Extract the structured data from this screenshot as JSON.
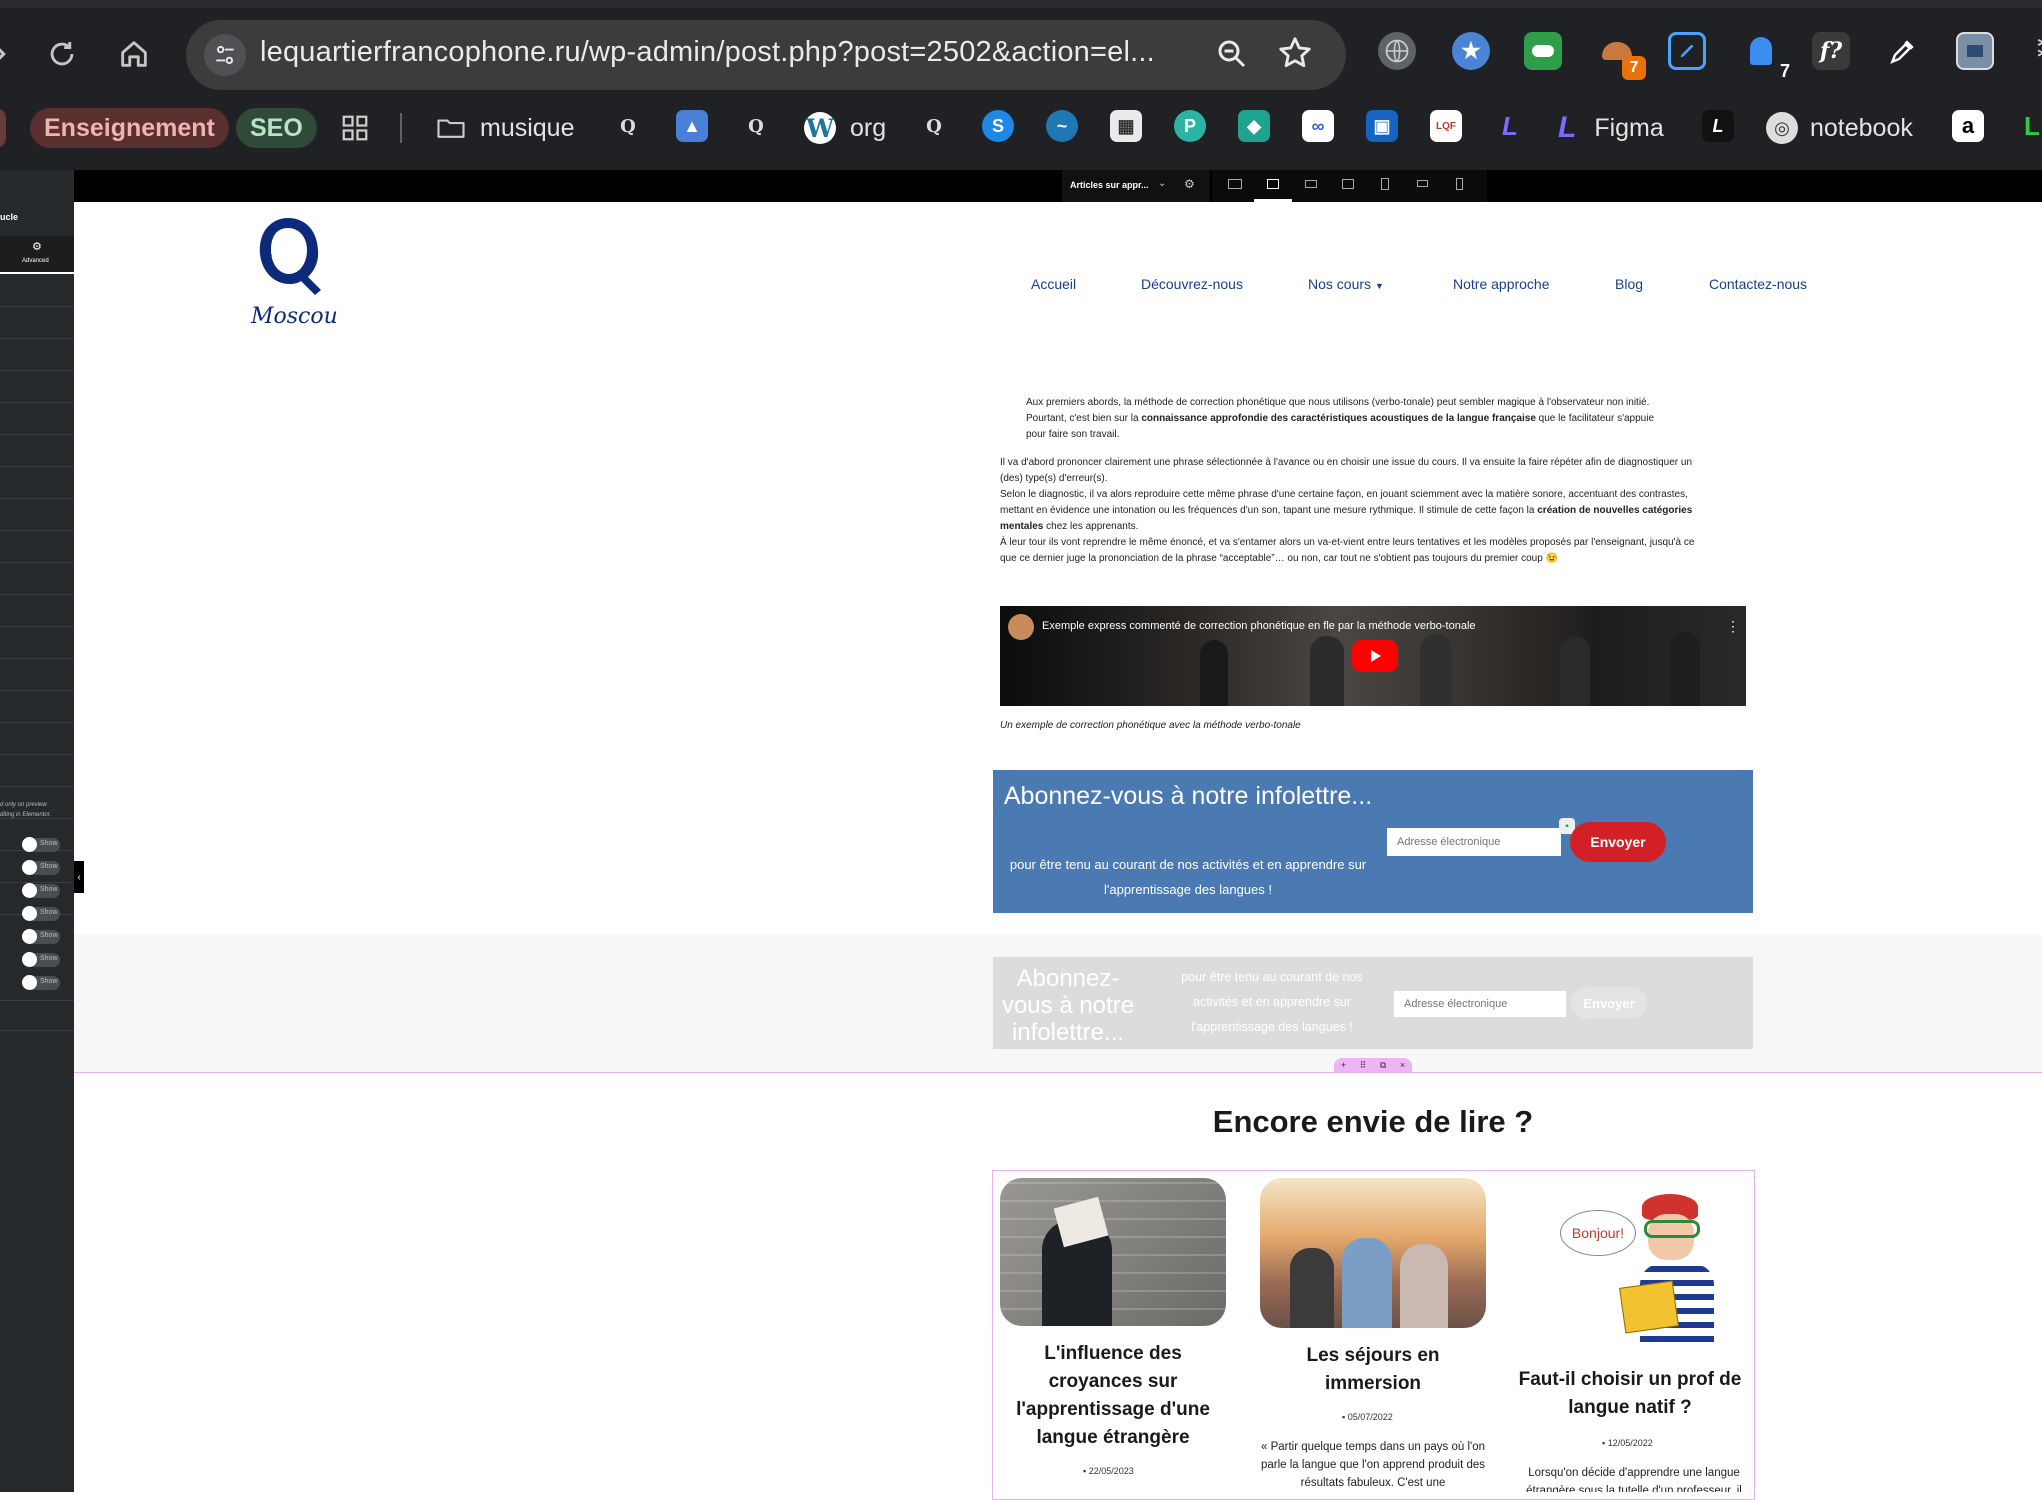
{
  "browser": {
    "url": "lequartierfrancophone.ru/wp-admin/post.php?post=2502&action=el...",
    "extensions": [
      {
        "name": "globe-icon",
        "badge": ""
      },
      {
        "name": "star-extension-icon",
        "badge": ""
      },
      {
        "name": "green-extension-icon",
        "badge": ""
      },
      {
        "name": "mushroom-extension-icon",
        "badge": "7"
      },
      {
        "name": "edit-extension-icon",
        "badge": ""
      },
      {
        "name": "ghost-extension-icon",
        "badge": "7"
      },
      {
        "name": "fx-extension-icon",
        "label": "f?"
      },
      {
        "name": "eyedropper-icon",
        "badge": ""
      },
      {
        "name": "image-info-icon",
        "badge": ""
      }
    ],
    "bookmarks": {
      "enseignement": "Enseignement",
      "seo": "SEO",
      "musique": "musique",
      "org": "org",
      "figma": "Figma",
      "notebook": "notebook"
    }
  },
  "elementor": {
    "panel_title": "ucle",
    "advanced_tab": "Advanced",
    "note_line1": "d only on preview",
    "note_line2": "diting in Elementor.",
    "toggle_label": "Show",
    "template_select": "Articles sur appr..."
  },
  "site": {
    "logo_text": "Moscou",
    "nav": [
      "Accueil",
      "Découvrez-nous",
      "Nos cours",
      "Notre approche",
      "Blog",
      "Contactez-nous"
    ]
  },
  "article": {
    "quote_p1": "Aux premiers abords, la méthode de correction phonétique que nous utilisons (verbo-tonale) peut sembler magique à l'observateur non initié.",
    "quote_p2a": "Pourtant, c'est bien sur la ",
    "quote_p2b": "connaissance approfondie des caractéristiques acoustiques de la langue française",
    "quote_p2c": " que le facilitateur s'appuie",
    "quote_p3": "pour faire son travail.",
    "p1": "Il va d'abord prononcer clairement une phrase sélectionnée à l'avance ou en choisir une issue du cours. Il va ensuite la faire répéter afin de diagnostiquer un",
    "p1b": "(des) type(s) d'erreur(s).",
    "p2": "Selon le diagnostic, il va alors reproduire cette même phrase d'une certaine façon, en jouant sciemment avec la matière sonore, accentuant des contrastes,",
    "p2b_a": "mettant en évidence une intonation ou les fréquences d'un son, tapant une mesure rythmique. Il stimule de cette façon la ",
    "p2b_b": "création de nouvelles catégories",
    "p2c_a": "mentales",
    "p2c_b": " chez les apprenants.",
    "p3": "À leur tour ils vont reprendre le même énoncé, et va s'entamer alors un va-et-vient entre leurs tentatives et les modèles proposés par l'enseignant, jusqu'à ce",
    "p3b": "que ce dernier juge la prononciation de la phrase “acceptable”… ou non, car tout ne s'obtient pas toujours du premier coup 😉",
    "video_title": "Exemple express commenté de correction phonétique en fle par la méthode verbo-tonale",
    "video_caption": "Un exemple de correction phonétique avec la méthode verbo-tonale"
  },
  "newsletter": {
    "title": "Abonnez-vous à notre infolettre...",
    "subtitle": "pour être tenu au courant de nos activités et en apprendre sur l'apprentissage des langues !",
    "placeholder": "Adresse électronique",
    "button": "Envoyer"
  },
  "more": {
    "heading": "Encore envie de lire ?",
    "cards": [
      {
        "title": "L'influence des croyances sur l'apprentissage d'une langue étrangère",
        "date": "22/05/2023",
        "excerpt": ""
      },
      {
        "title": "Les séjours en immersion",
        "date": "05/07/2022",
        "excerpt": "« Partir quelque temps dans un pays où l'on parle la langue que l'on apprend produit des résultats fabuleux. C'est une"
      },
      {
        "title": "Faut-il choisir un prof de langue natif ?",
        "date": "12/05/2022",
        "excerpt": "Lorsqu'on décide d'apprendre une langue étrangère sous la tutelle d'un professeur, il",
        "bubble": "Bonjour!"
      }
    ]
  },
  "colors": {
    "brand_blue": "#1a3e8c",
    "newsletter_bg": "#4b7ab3",
    "button_red": "#d32027",
    "chrome_bg": "#202124"
  }
}
